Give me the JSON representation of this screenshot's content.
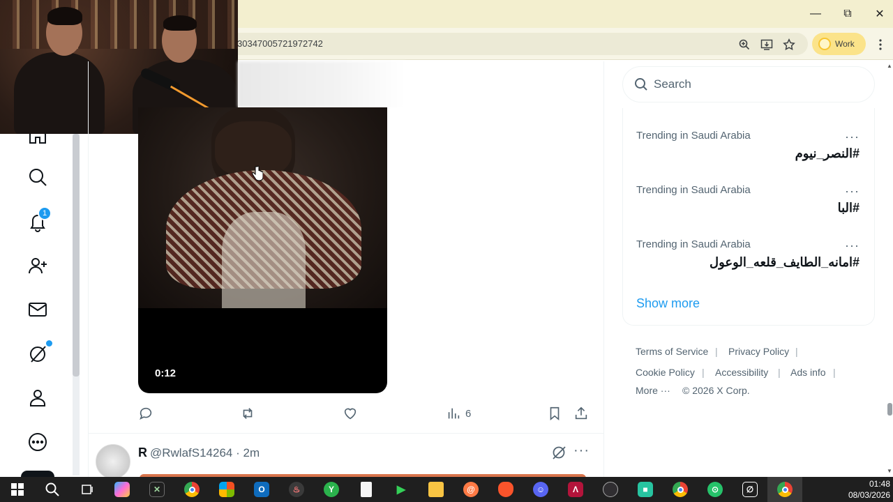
{
  "browser": {
    "url_fragment": "30347005721972742",
    "profile_label": "Work"
  },
  "video": {
    "timestamp": "0:12"
  },
  "post_actions": {
    "views": "6"
  },
  "nav": {
    "notification_count": "1"
  },
  "next_post": {
    "name": "R",
    "handle": "@RwlafS14264 · 2m"
  },
  "search": {
    "placeholder": "Search"
  },
  "trends": [
    {
      "context": "Trending in Saudi Arabia",
      "title": "#النصر_نيوم"
    },
    {
      "context": "Trending in Saudi Arabia",
      "title": "#البا"
    },
    {
      "context": "Trending in Saudi Arabia",
      "title": "#امانه_الطايف_قلعه_الوعول"
    }
  ],
  "show_more": "Show more",
  "footer": {
    "terms": "Terms of Service",
    "privacy": "Privacy Policy",
    "cookie": "Cookie Policy",
    "accessibility": "Accessibility",
    "ads": "Ads info",
    "more": "More ···",
    "copyright": "© 2026 X Corp."
  },
  "clock": {
    "time": "01:48",
    "date": "08/03/2026"
  },
  "colors": {
    "accent": "#1d9bf0",
    "titlebar": "#f3efcf"
  },
  "taskbar_icons": [
    "windows-start-icon",
    "search-icon",
    "task-view-icon",
    "copilot-icon",
    "xbox-icon",
    "chrome-icon",
    "store-icon",
    "outlook-icon",
    "tool-icon",
    "feedly-icon",
    "file-icon",
    "play-icon",
    "folder-icon",
    "spiral-icon",
    "brave-icon",
    "discord-icon",
    "app-a-icon",
    "obs-icon",
    "teams-icon",
    "chrome-icon",
    "hotspot-icon",
    "grok-icon",
    "chrome-active-icon"
  ]
}
